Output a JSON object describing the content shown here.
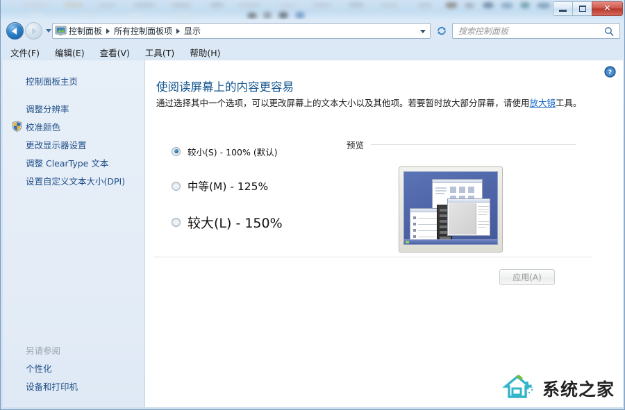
{
  "window": {
    "title": "",
    "controls": {
      "minimize": "–",
      "maximize": "▢",
      "close": "X"
    }
  },
  "navigation": {
    "back_label": "后退",
    "forward_label": "前进",
    "history_label": "最近浏览的位置",
    "refresh_label": "刷新",
    "breadcrumb": [
      "控制面板",
      "所有控制面板项",
      "显示"
    ]
  },
  "search": {
    "placeholder": "搜索控制面板",
    "value": "",
    "icon": "search-icon"
  },
  "menubar": {
    "items": [
      "文件(F)",
      "编辑(E)",
      "查看(V)",
      "工具(T)",
      "帮助(H)"
    ]
  },
  "sidebar": {
    "home": "控制面板主页",
    "items": [
      {
        "label": "调整分辨率",
        "icon": null
      },
      {
        "label": "校准颜色",
        "icon": "uac-shield-icon"
      },
      {
        "label": "更改显示器设置",
        "icon": null
      },
      {
        "label": "调整 ClearType 文本",
        "icon": null
      },
      {
        "label": "设置自定义文本大小(DPI)",
        "icon": null
      }
    ],
    "see_also_header": "另请参阅",
    "see_also_items": [
      "个性化",
      "设备和打印机"
    ]
  },
  "content": {
    "help_icon": "help-icon",
    "heading": "使阅读屏幕上的内容更容易",
    "description_part1": "通过选择其中一个选项，可以更改屏幕上的文本大小以及其他项。若要暂时放大部分屏幕，请使用",
    "description_link": "放大镜",
    "description_part2": "工具。",
    "scaling_options": [
      {
        "label": "较小(S) - 100% (默认)",
        "selected": true,
        "percent": "100%"
      },
      {
        "label": "中等(M) - 125%",
        "selected": false,
        "percent": "125%"
      },
      {
        "label": "较大(L) - 150%",
        "selected": false,
        "percent": "150%"
      }
    ],
    "preview_label": "预览",
    "apply_label": "应用(A)",
    "apply_enabled": false
  },
  "watermark": {
    "text": "系统之家",
    "icon": "house-logo-icon"
  },
  "colors": {
    "accent_blue": "#1f4e87",
    "heading_blue": "#12558f",
    "link_blue": "#0b63c5",
    "close_red": "#b8392c",
    "desktop_blue": "#4d64a6"
  }
}
